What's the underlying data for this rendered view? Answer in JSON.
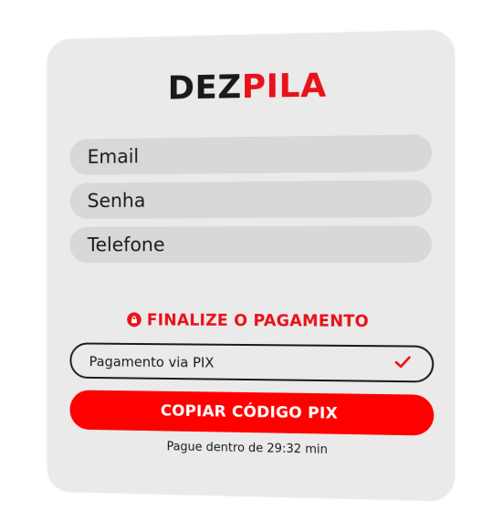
{
  "logo": {
    "part1": "DEZ",
    "part2": "PILA"
  },
  "form": {
    "email_placeholder": "Email",
    "senha_placeholder": "Senha",
    "telefone_placeholder": "Telefone"
  },
  "payment": {
    "heading": "FINALIZE O PAGAMENTO",
    "method_label": "Pagamento via PIX",
    "copy_button": "COPIAR CÓDIGO PIX",
    "timer_text": "Pague dentro de 29:32 min"
  },
  "colors": {
    "accent": "#e8121b",
    "button": "#ff0000",
    "card_bg": "#ebeaea",
    "field_bg": "#d9d8d8"
  },
  "icons": {
    "lock": "lock-icon",
    "check": "check-icon"
  }
}
